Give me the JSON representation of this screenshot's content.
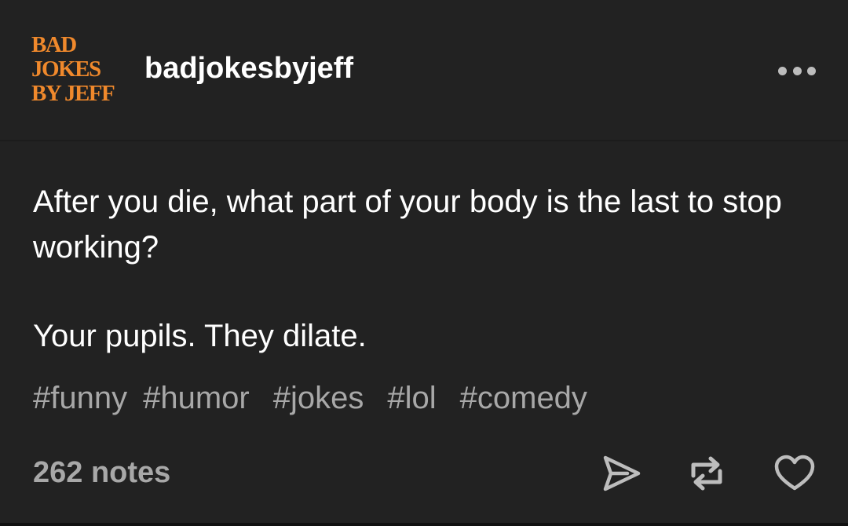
{
  "post": {
    "avatar_lines": [
      "BAD",
      "JOKES",
      "BY JEFF"
    ],
    "username": "badjokesbyjeff",
    "question": "After you die, what part of your body is the last to stop working?",
    "answer": "Your pupils. They dilate.",
    "tags": [
      "#funny",
      "#humor",
      "#jokes",
      "#lol",
      "#comedy"
    ],
    "notes": "262 notes"
  },
  "icons": {
    "more": "more-options-icon",
    "share": "share-icon",
    "reblog": "reblog-icon",
    "like": "heart-icon"
  },
  "colors": {
    "background": "#222222",
    "avatar_text": "#f0892c",
    "primary_text": "#ffffff",
    "secondary_text": "#a8a8a8"
  }
}
